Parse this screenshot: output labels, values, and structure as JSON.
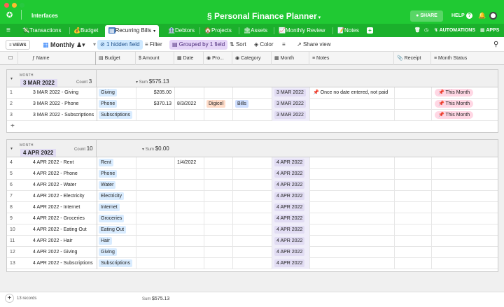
{
  "window": {
    "workspace_label": "Interfaces",
    "base_title": "Personal Finance Planner",
    "share_label": "SHARE",
    "help_label": "HELP"
  },
  "tabs": [
    {
      "label": "Transactions",
      "active": false
    },
    {
      "label": "Budget",
      "active": false
    },
    {
      "label": "Recurring Bills",
      "active": true
    },
    {
      "label": "Debtors",
      "active": false
    },
    {
      "label": "Projects",
      "active": false
    },
    {
      "label": "Assets",
      "active": false
    },
    {
      "label": "Monthly Review",
      "active": false
    },
    {
      "label": "Notes",
      "active": false
    }
  ],
  "right_tools": {
    "automations": "AUTOMATIONS",
    "apps": "APPS"
  },
  "viewbar": {
    "views": "VIEWS",
    "current_view": "Monthly",
    "hidden_fields": "1 hidden field",
    "filter": "Filter",
    "grouped": "Grouped by 1 field",
    "sort": "Sort",
    "color": "Color",
    "share_view": "Share view"
  },
  "columns": [
    "Name",
    "Budget",
    "Amount",
    "Date",
    "Pro...",
    "Category",
    "Month",
    "Notes",
    "Receipt",
    "Month Status"
  ],
  "groups": [
    {
      "field_label": "MONTH",
      "value": "3 MAR 2022",
      "count_label": "Count",
      "count": "3",
      "sum_label": "Sum",
      "sum": "$575.13",
      "rows": [
        {
          "num": "1",
          "name": "3 MAR 2022 - Giving",
          "budget": "Giving",
          "amount": "$205.00",
          "date": "",
          "pro": "",
          "category": "",
          "month": "3 MAR 2022",
          "notes": "📌 Once no date entered, not paid",
          "status": "📌 This Month"
        },
        {
          "num": "2",
          "name": "3 MAR 2022 - Phone",
          "budget": "Phone",
          "amount": "$370.13",
          "date": "8/3/2022",
          "pro": "Digicel",
          "category": "Bills",
          "month": "3 MAR 2022",
          "notes": "",
          "status": "📌 This Month"
        },
        {
          "num": "3",
          "name": "3 MAR 2022 - Subscriptions",
          "budget": "Subscriptions",
          "amount": "",
          "date": "",
          "pro": "",
          "category": "",
          "month": "3 MAR 2022",
          "notes": "",
          "status": "📌 This Month"
        }
      ]
    },
    {
      "field_label": "MONTH",
      "value": "4 APR 2022",
      "count_label": "Count",
      "count": "10",
      "sum_label": "Sum",
      "sum": "$0.00",
      "rows": [
        {
          "num": "4",
          "name": "4 APR 2022 - Rent",
          "budget": "Rent",
          "amount": "",
          "date": "1/4/2022",
          "month": "4 APR 2022"
        },
        {
          "num": "5",
          "name": "4 APR 2022 - Phone",
          "budget": "Phone",
          "amount": "",
          "date": "",
          "month": "4 APR 2022"
        },
        {
          "num": "6",
          "name": "4 APR 2022 - Water",
          "budget": "Water",
          "amount": "",
          "date": "",
          "month": "4 APR 2022"
        },
        {
          "num": "7",
          "name": "4 APR 2022 - Electricity",
          "budget": "Electricity",
          "amount": "",
          "date": "",
          "month": "4 APR 2022"
        },
        {
          "num": "8",
          "name": "4 APR 2022 - Internet",
          "budget": "Internet",
          "amount": "",
          "date": "",
          "month": "4 APR 2022"
        },
        {
          "num": "9",
          "name": "4 APR 2022 - Groceries",
          "budget": "Groceries",
          "amount": "",
          "date": "",
          "month": "4 APR 2022"
        },
        {
          "num": "10",
          "name": "4 APR 2022 - Eating Out",
          "budget": "Eating Out",
          "amount": "",
          "date": "",
          "month": "4 APR 2022"
        },
        {
          "num": "11",
          "name": "4 APR 2022 - Hair",
          "budget": "Hair",
          "amount": "",
          "date": "",
          "month": "4 APR 2022"
        },
        {
          "num": "12",
          "name": "4 APR 2022 - Giving",
          "budget": "Giving",
          "amount": "",
          "date": "",
          "month": "4 APR 2022"
        },
        {
          "num": "13",
          "name": "4 APR 2022 - Subscriptions",
          "budget": "Subscriptions",
          "amount": "",
          "date": "",
          "month": "4 APR 2022"
        }
      ]
    }
  ],
  "footer": {
    "records": "13 records",
    "sum_label": "Sum",
    "sum": "$575.13"
  },
  "colors": {
    "brand_green": "#20c933",
    "month_purple": "#e1dcf3",
    "budget_blue": "#d9ecff",
    "status_pink": "#ffd7e4"
  }
}
